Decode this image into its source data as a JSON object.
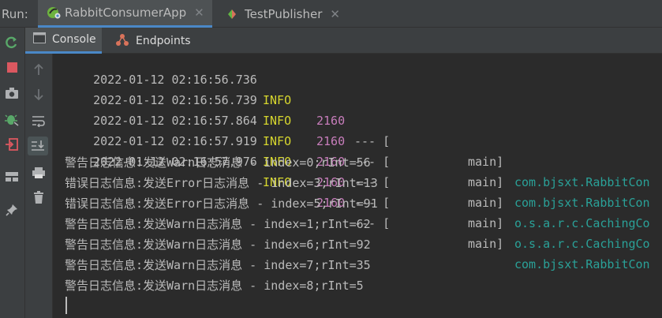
{
  "run_label": "Run:",
  "run_tabs": [
    {
      "label": "RabbitConsumerApp",
      "icon": "spring-boot-icon",
      "active": true
    },
    {
      "label": "TestPublisher",
      "icon": "debug-diamond-icon",
      "active": false
    }
  ],
  "subtabs": [
    {
      "label": "Console",
      "icon": "console-icon",
      "active": true
    },
    {
      "label": "Endpoints",
      "icon": "endpoints-icon",
      "active": false
    }
  ],
  "log_lines": [
    {
      "timestamp": "2022-01-12 02:16:56.736",
      "level": "INFO",
      "pid": "2160",
      "sep": "--- [",
      "thread": "main]",
      "logger": "com.bjsxt.RabbitCon"
    },
    {
      "timestamp": "2022-01-12 02:16:56.739",
      "level": "INFO",
      "pid": "2160",
      "sep": "--- [",
      "thread": "main]",
      "logger": "com.bjsxt.RabbitCon"
    },
    {
      "timestamp": "2022-01-12 02:16:57.864",
      "level": "INFO",
      "pid": "2160",
      "sep": "--- [",
      "thread": "main]",
      "logger": "o.s.a.r.c.CachingCo"
    },
    {
      "timestamp": "2022-01-12 02:16:57.919",
      "level": "INFO",
      "pid": "2160",
      "sep": "--- [",
      "thread": "main]",
      "logger": "o.s.a.r.c.CachingCo"
    },
    {
      "timestamp": "2022-01-12 02:16:57.976",
      "level": "INFO",
      "pid": "2160",
      "sep": "--- [",
      "thread": "main]",
      "logger": "com.bjsxt.RabbitCon"
    }
  ],
  "messages": [
    "警告日志信息:发送Warn日志消息 - index=0;rInt=56",
    "错误日志信息:发送Error日志消息 - index=3;rInt=13",
    "错误日志信息:发送Error日志消息 - index=5;rInt=91",
    "警告日志信息:发送Warn日志消息 - index=1;rInt=62",
    "警告日志信息:发送Warn日志消息 - index=6;rInt=92",
    "警告日志信息:发送Warn日志消息 - index=7;rInt=35",
    "警告日志信息:发送Warn日志消息 - index=8;rInt=5"
  ],
  "colors": {
    "info": "#d6d62e",
    "pid": "#c77dbb",
    "logger": "#2aa198",
    "accent": "#4a88c7"
  }
}
